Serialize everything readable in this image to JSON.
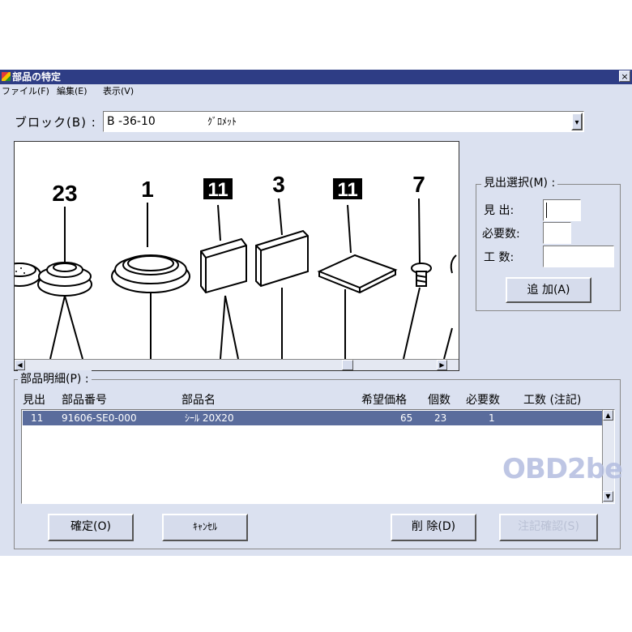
{
  "window": {
    "title": "部品の特定",
    "close_glyph": "×"
  },
  "menu": {
    "items": [
      "ファイル(F)",
      "編集(E)",
      "表示(V)"
    ]
  },
  "block": {
    "label": "ブロック(B) :",
    "code": "B  -36-10",
    "name": "ｸﾞﾛﾒｯﾄ",
    "arrow": "▾"
  },
  "diagram": {
    "labels": [
      "23",
      "1",
      "11",
      "3",
      "11",
      "7"
    ],
    "boxed": [
      false,
      false,
      true,
      false,
      true,
      false
    ]
  },
  "selection": {
    "title": "見出選択(M) :",
    "midashi_label": "見 出:",
    "midashi_value": "",
    "required_label": "必要数:",
    "required_value": "",
    "labor_label": "工 数:",
    "labor_value": "",
    "add_button": "追 加(A)"
  },
  "details": {
    "title": "部品明細(P) :",
    "columns": [
      "見出",
      "部品番号",
      "部品名",
      "希望価格",
      "個数",
      "必要数",
      "工数 (注記)"
    ],
    "rows": [
      {
        "midashi": "11",
        "part_no": "91606-SE0-000",
        "name": "ｼｰﾙ 20X20",
        "price": "65",
        "qty": "23",
        "required": "1",
        "labor": ""
      }
    ]
  },
  "buttons": {
    "confirm": "確定(O)",
    "cancel": "ｷｬﾝｾﾙ",
    "delete": "削 除(D)",
    "note_confirm": "注記確認(S)"
  },
  "watermark": "OBD2be"
}
